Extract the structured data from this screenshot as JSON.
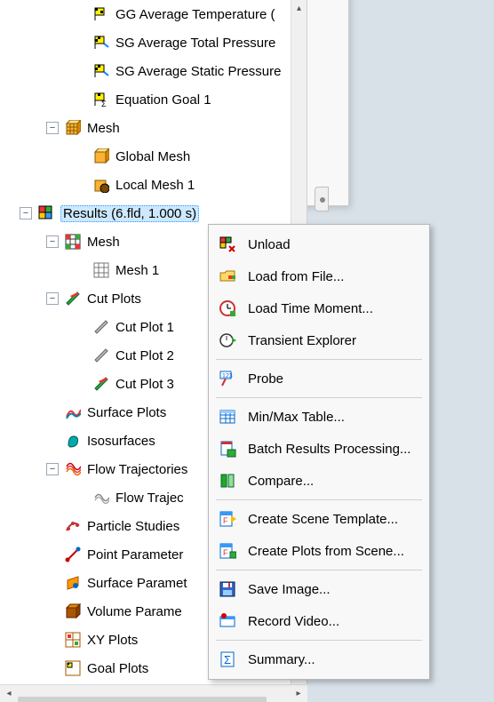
{
  "tree": {
    "gg_avg_temp": "GG Average Temperature (",
    "sg_avg_total": "SG Average Total Pressure",
    "sg_avg_static": "SG Average Static Pressure",
    "equation_goal": "Equation Goal 1",
    "mesh": "Mesh",
    "global_mesh": "Global Mesh",
    "local_mesh": "Local Mesh 1",
    "results": "Results (6.fld, 1.000 s)",
    "results_mesh": "Mesh",
    "mesh1": "Mesh 1",
    "cut_plots": "Cut Plots",
    "cp1": "Cut Plot 1",
    "cp2": "Cut Plot 2",
    "cp3": "Cut Plot 3",
    "surface_plots": "Surface Plots",
    "isosurfaces": "Isosurfaces",
    "flow_traj": "Flow Trajectories",
    "flow_traj1": "Flow Trajec",
    "particle": "Particle Studies",
    "point_param": "Point Parameter",
    "surface_param": "Surface Paramet",
    "volume_param": "Volume Parame",
    "xy_plots": "XY Plots",
    "goal_plots": "Goal Plots"
  },
  "menu": {
    "unload": "Unload",
    "load_file": "Load from File...",
    "load_time": "Load Time Moment...",
    "transient": "Transient Explorer",
    "probe": "Probe",
    "minmax": "Min/Max Table...",
    "batch": "Batch Results Processing...",
    "compare": "Compare...",
    "scene_tpl": "Create Scene Template...",
    "plots_scene": "Create Plots from Scene...",
    "save_img": "Save Image...",
    "record": "Record Video...",
    "summary": "Summary..."
  }
}
